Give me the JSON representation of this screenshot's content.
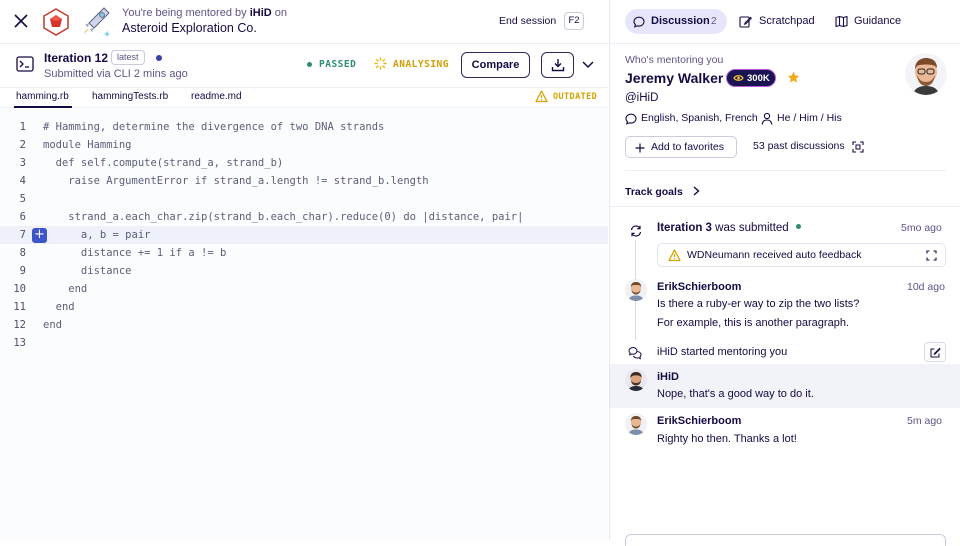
{
  "header": {
    "mentored_prefix": "You're being mentored by",
    "mentor_handle": "iHiD",
    "mentored_suffix": "on",
    "exercise_title": "Asteroid Exploration Co.",
    "end_session_label": "End session",
    "end_session_key": "F2"
  },
  "iteration_bar": {
    "title": "Iteration 12",
    "latest_badge": "latest",
    "submitted_text": "Submitted via CLI 2 mins ago",
    "passed_label": "PASSED",
    "analysing_label": "ANALYSING",
    "compare_label": "Compare"
  },
  "file_tabs": {
    "tabs": [
      "hamming.rb",
      "hammingTests.rb",
      "readme.md"
    ],
    "outdated_label": "OUTDATED"
  },
  "code": {
    "highlighted_line": 7,
    "lines": [
      {
        "n": "1",
        "text": "# Hamming, determine the divergence of two DNA strands"
      },
      {
        "n": "2",
        "text": "module Hamming"
      },
      {
        "n": "3",
        "text": "  def self.compute(strand_a, strand_b)"
      },
      {
        "n": "4",
        "text": "    raise ArgumentError if strand_a.length != strand_b.length"
      },
      {
        "n": "5",
        "text": ""
      },
      {
        "n": "6",
        "text": "    strand_a.each_char.zip(strand_b.each_char).reduce(0) do |distance, pair|"
      },
      {
        "n": "7",
        "text": "      a, b = pair"
      },
      {
        "n": "8",
        "text": "      distance += 1 if a != b"
      },
      {
        "n": "9",
        "text": "      distance"
      },
      {
        "n": "10",
        "text": "    end"
      },
      {
        "n": "11",
        "text": "  end"
      },
      {
        "n": "12",
        "text": "end"
      },
      {
        "n": "13",
        "text": ""
      }
    ]
  },
  "right_tabs": {
    "discussion_label": "Discussion",
    "discussion_count": "2",
    "scratchpad_label": "Scratchpad",
    "guidance_label": "Guidance"
  },
  "mentor": {
    "heading": "Who's mentoring you",
    "name": "Jeremy Walker",
    "reputation": "300K",
    "handle": "@iHiD",
    "languages": "English, Spanish, French",
    "pronouns": "He / Him / His",
    "add_favorites_label": "Add to favorites",
    "past_discussions": "53 past discussions",
    "track_goals_label": "Track goals"
  },
  "timeline": {
    "iteration_submitted_prefix": "Iteration 3",
    "iteration_submitted_suffix": "was submitted",
    "iteration_time": "5mo ago",
    "auto_feedback_text": "WDNeumann received auto feedback",
    "messages": [
      {
        "author": "ErikSchierboom",
        "time": "10d ago",
        "lines": [
          "Is there a ruby-er way to zip the two lists?",
          "For example, this is another paragraph."
        ]
      },
      {
        "author": "iHiD",
        "time": "",
        "lines": [
          "Nope, that's a good way to do it."
        ]
      },
      {
        "author": "ErikSchierboom",
        "time": "5m ago",
        "lines": [
          "Righty ho then. Thanks a lot!"
        ]
      }
    ],
    "started_mentoring_text": "iHiD started mentoring you"
  },
  "colors": {
    "accent": "#604fcd",
    "passed": "#2e8c70",
    "analysing": "#f0b400",
    "outdated": "#d4a200",
    "highlight_row": "#eef0fa",
    "tab_active_bg": "#e7e5fb"
  }
}
